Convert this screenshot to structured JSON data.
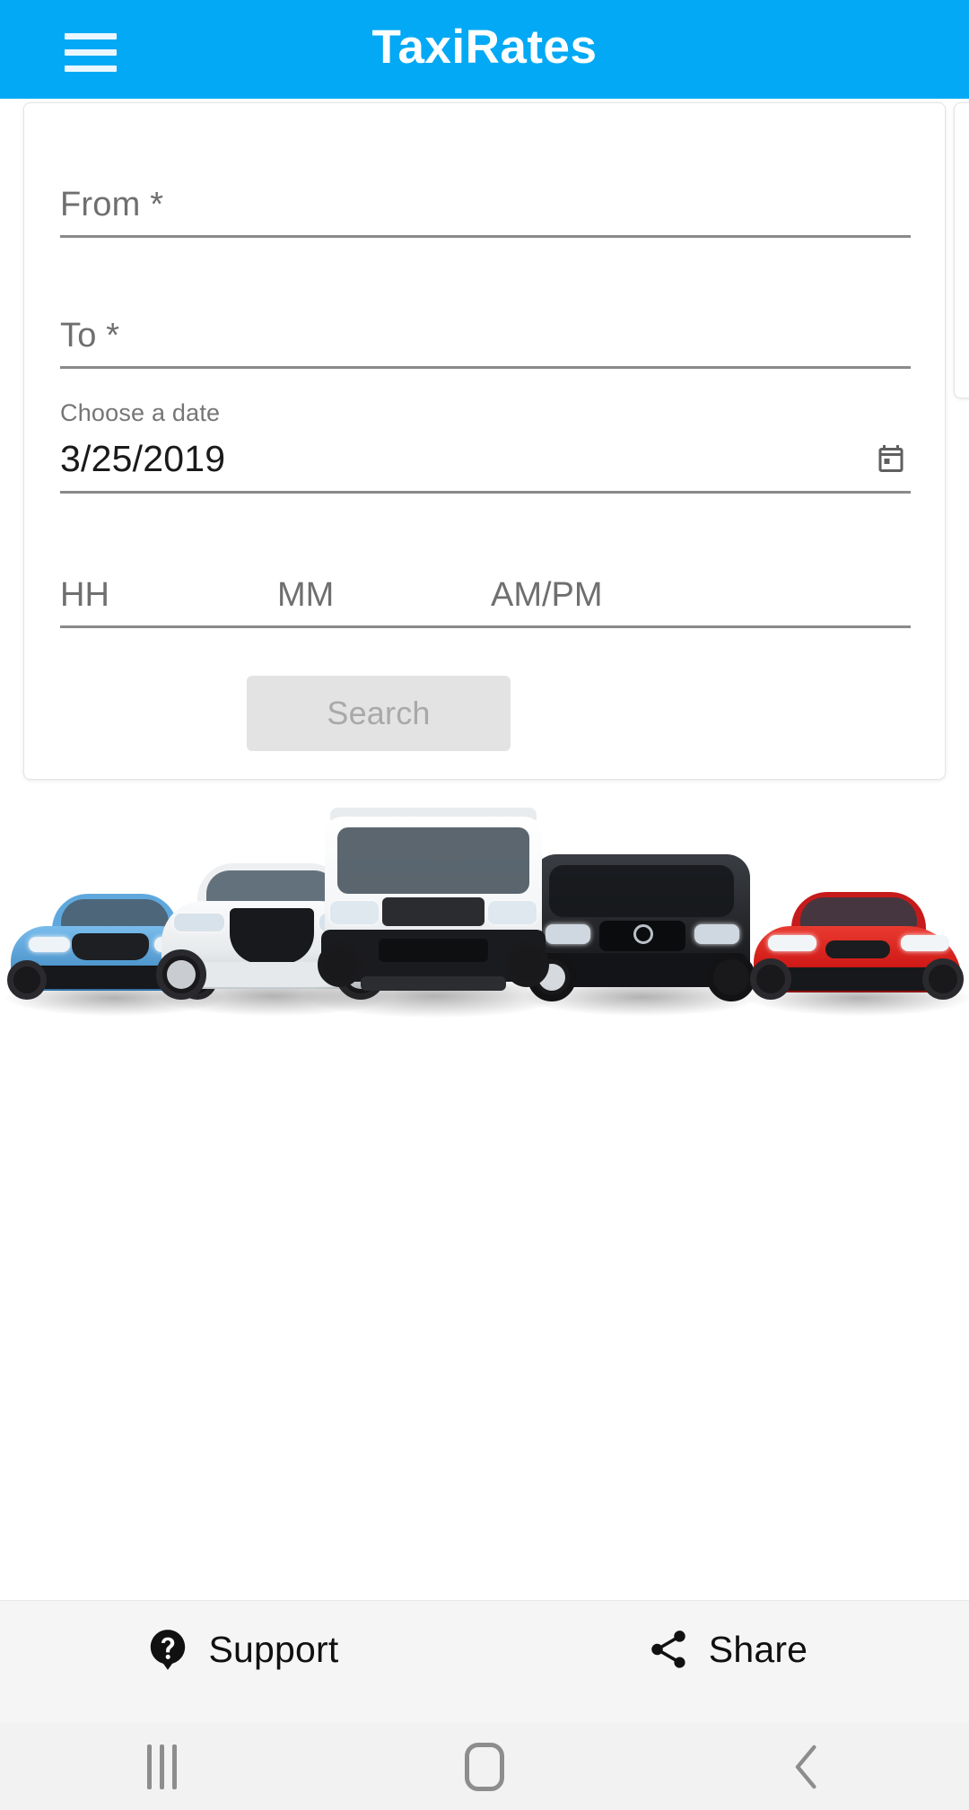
{
  "appbar": {
    "title": "TaxiRates",
    "menu_icon": "hamburger-menu-icon",
    "background_color": "#03A9F4",
    "title_color": "#FFFFFF"
  },
  "search_card": {
    "from_field": {
      "placeholder": "From *",
      "value": ""
    },
    "to_field": {
      "placeholder": "To *",
      "value": ""
    },
    "date_field": {
      "label": "Choose a date",
      "value": "3/25/2019",
      "icon": "calendar-icon"
    },
    "time_field": {
      "hour_placeholder": "HH",
      "minute_placeholder": "MM",
      "meridiem_placeholder": "AM/PM",
      "hour_value": "",
      "minute_value": "",
      "meridiem_value": ""
    },
    "search_button": {
      "label": "Search",
      "disabled": true,
      "background_color": "#E3E3E3",
      "text_color": "#A9A9A9"
    }
  },
  "hero": {
    "alt": "Fleet of vehicles: blue coupe, white SUV, white cargo van, black passenger van, red sedan",
    "vehicles": [
      {
        "name": "blue-coupe",
        "color": "#5FA8DE"
      },
      {
        "name": "white-suv",
        "color": "#F2F3F5"
      },
      {
        "name": "white-cargo-van",
        "color": "#FDFDFD"
      },
      {
        "name": "black-passenger-van",
        "color": "#26282C"
      },
      {
        "name": "red-sedan",
        "color": "#D41F1F"
      }
    ]
  },
  "bottom_bar": {
    "items": [
      {
        "label": "Support",
        "icon": "help-support-icon"
      },
      {
        "label": "Share",
        "icon": "share-icon"
      }
    ]
  },
  "nav_bar": {
    "items": [
      {
        "name": "recents",
        "icon": "recents-icon"
      },
      {
        "name": "home",
        "icon": "home-icon"
      },
      {
        "name": "back",
        "icon": "back-chevron-icon"
      }
    ]
  }
}
